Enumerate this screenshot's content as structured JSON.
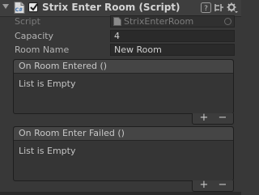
{
  "component": {
    "title": "Strix Enter Room (Script)"
  },
  "fields": {
    "script": {
      "label": "Script",
      "value": "StrixEnterRoom"
    },
    "capacity": {
      "label": "Capacity",
      "value": "4"
    },
    "room_name": {
      "label": "Room Name",
      "value": "New Room"
    }
  },
  "events": [
    {
      "header": "On Room Entered ()",
      "empty_text": "List is Empty",
      "add_label": "+",
      "remove_label": "−"
    },
    {
      "header": "On Room Enter Failed ()",
      "empty_text": "List is Empty",
      "add_label": "+",
      "remove_label": "−"
    }
  ],
  "icons": {
    "foldout": "chevron-down-icon",
    "script": "cs-script-icon",
    "help": "help-icon",
    "preset": "preset-icon",
    "settings": "gear-icon"
  },
  "colors": {
    "background": "#383838",
    "field": "#2a2a2a",
    "event_header": "#454545",
    "checkbox": "#e6e6e6"
  }
}
